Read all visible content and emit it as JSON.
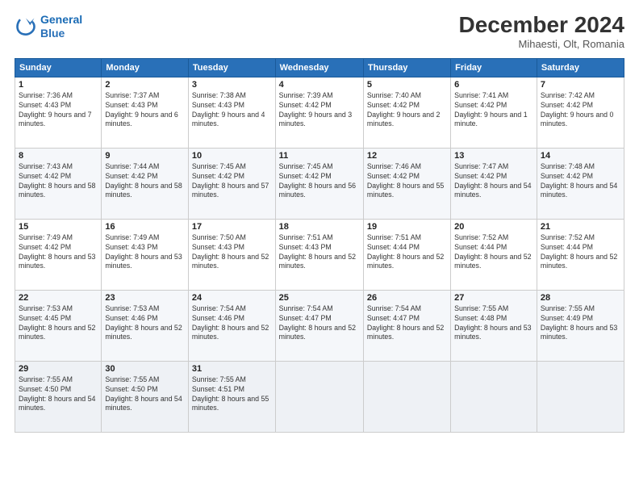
{
  "header": {
    "logo_line1": "General",
    "logo_line2": "Blue",
    "month": "December 2024",
    "location": "Mihaesti, Olt, Romania"
  },
  "weekdays": [
    "Sunday",
    "Monday",
    "Tuesday",
    "Wednesday",
    "Thursday",
    "Friday",
    "Saturday"
  ],
  "weeks": [
    [
      {
        "day": "1",
        "sunrise": "7:36 AM",
        "sunset": "4:43 PM",
        "daylight": "9 hours and 7 minutes."
      },
      {
        "day": "2",
        "sunrise": "7:37 AM",
        "sunset": "4:43 PM",
        "daylight": "9 hours and 6 minutes."
      },
      {
        "day": "3",
        "sunrise": "7:38 AM",
        "sunset": "4:43 PM",
        "daylight": "9 hours and 4 minutes."
      },
      {
        "day": "4",
        "sunrise": "7:39 AM",
        "sunset": "4:42 PM",
        "daylight": "9 hours and 3 minutes."
      },
      {
        "day": "5",
        "sunrise": "7:40 AM",
        "sunset": "4:42 PM",
        "daylight": "9 hours and 2 minutes."
      },
      {
        "day": "6",
        "sunrise": "7:41 AM",
        "sunset": "4:42 PM",
        "daylight": "9 hours and 1 minute."
      },
      {
        "day": "7",
        "sunrise": "7:42 AM",
        "sunset": "4:42 PM",
        "daylight": "9 hours and 0 minutes."
      }
    ],
    [
      {
        "day": "8",
        "sunrise": "7:43 AM",
        "sunset": "4:42 PM",
        "daylight": "8 hours and 58 minutes."
      },
      {
        "day": "9",
        "sunrise": "7:44 AM",
        "sunset": "4:42 PM",
        "daylight": "8 hours and 58 minutes."
      },
      {
        "day": "10",
        "sunrise": "7:45 AM",
        "sunset": "4:42 PM",
        "daylight": "8 hours and 57 minutes."
      },
      {
        "day": "11",
        "sunrise": "7:45 AM",
        "sunset": "4:42 PM",
        "daylight": "8 hours and 56 minutes."
      },
      {
        "day": "12",
        "sunrise": "7:46 AM",
        "sunset": "4:42 PM",
        "daylight": "8 hours and 55 minutes."
      },
      {
        "day": "13",
        "sunrise": "7:47 AM",
        "sunset": "4:42 PM",
        "daylight": "8 hours and 54 minutes."
      },
      {
        "day": "14",
        "sunrise": "7:48 AM",
        "sunset": "4:42 PM",
        "daylight": "8 hours and 54 minutes."
      }
    ],
    [
      {
        "day": "15",
        "sunrise": "7:49 AM",
        "sunset": "4:42 PM",
        "daylight": "8 hours and 53 minutes."
      },
      {
        "day": "16",
        "sunrise": "7:49 AM",
        "sunset": "4:43 PM",
        "daylight": "8 hours and 53 minutes."
      },
      {
        "day": "17",
        "sunrise": "7:50 AM",
        "sunset": "4:43 PM",
        "daylight": "8 hours and 52 minutes."
      },
      {
        "day": "18",
        "sunrise": "7:51 AM",
        "sunset": "4:43 PM",
        "daylight": "8 hours and 52 minutes."
      },
      {
        "day": "19",
        "sunrise": "7:51 AM",
        "sunset": "4:44 PM",
        "daylight": "8 hours and 52 minutes."
      },
      {
        "day": "20",
        "sunrise": "7:52 AM",
        "sunset": "4:44 PM",
        "daylight": "8 hours and 52 minutes."
      },
      {
        "day": "21",
        "sunrise": "7:52 AM",
        "sunset": "4:44 PM",
        "daylight": "8 hours and 52 minutes."
      }
    ],
    [
      {
        "day": "22",
        "sunrise": "7:53 AM",
        "sunset": "4:45 PM",
        "daylight": "8 hours and 52 minutes."
      },
      {
        "day": "23",
        "sunrise": "7:53 AM",
        "sunset": "4:46 PM",
        "daylight": "8 hours and 52 minutes."
      },
      {
        "day": "24",
        "sunrise": "7:54 AM",
        "sunset": "4:46 PM",
        "daylight": "8 hours and 52 minutes."
      },
      {
        "day": "25",
        "sunrise": "7:54 AM",
        "sunset": "4:47 PM",
        "daylight": "8 hours and 52 minutes."
      },
      {
        "day": "26",
        "sunrise": "7:54 AM",
        "sunset": "4:47 PM",
        "daylight": "8 hours and 52 minutes."
      },
      {
        "day": "27",
        "sunrise": "7:55 AM",
        "sunset": "4:48 PM",
        "daylight": "8 hours and 53 minutes."
      },
      {
        "day": "28",
        "sunrise": "7:55 AM",
        "sunset": "4:49 PM",
        "daylight": "8 hours and 53 minutes."
      }
    ],
    [
      {
        "day": "29",
        "sunrise": "7:55 AM",
        "sunset": "4:50 PM",
        "daylight": "8 hours and 54 minutes."
      },
      {
        "day": "30",
        "sunrise": "7:55 AM",
        "sunset": "4:50 PM",
        "daylight": "8 hours and 54 minutes."
      },
      {
        "day": "31",
        "sunrise": "7:55 AM",
        "sunset": "4:51 PM",
        "daylight": "8 hours and 55 minutes."
      },
      null,
      null,
      null,
      null
    ]
  ]
}
